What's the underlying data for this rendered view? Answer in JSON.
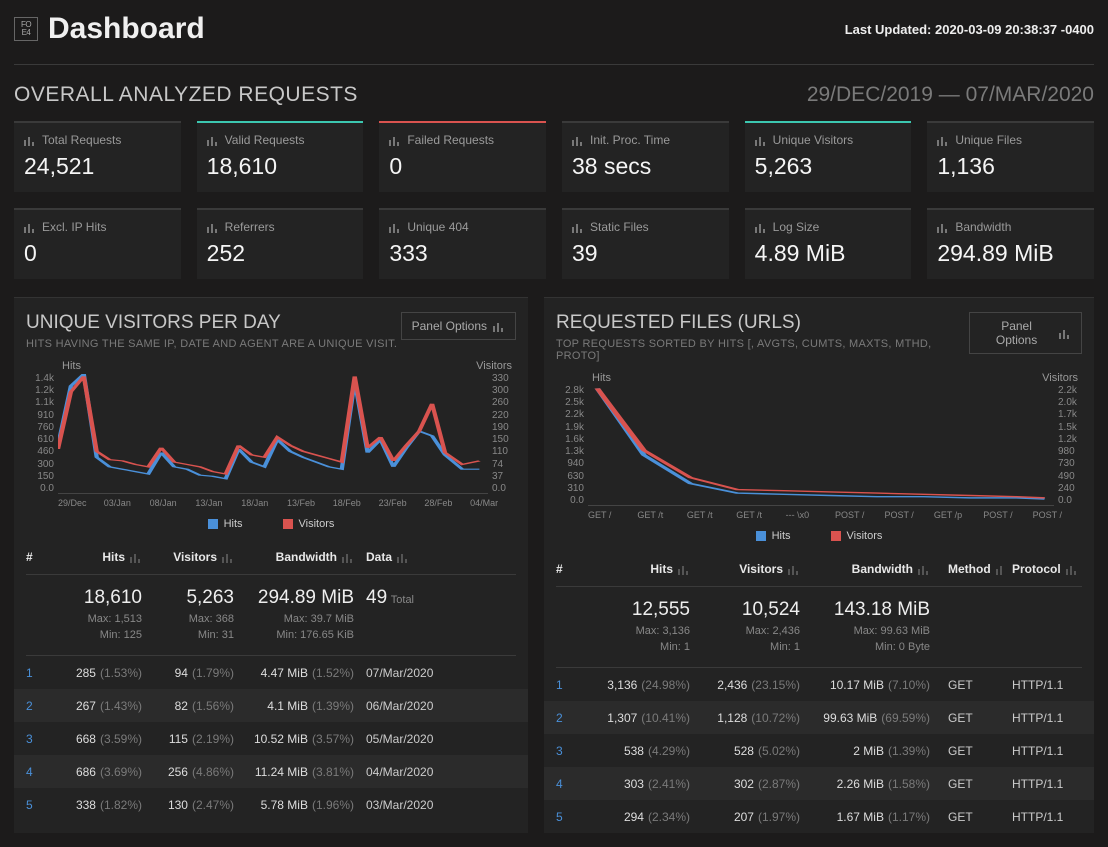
{
  "header": {
    "brand": "Dashboard",
    "last_updated_label": "Last Updated:",
    "last_updated_value": "2020-03-09 20:38:37 -0400"
  },
  "overview": {
    "title": "OVERALL ANALYZED REQUESTS",
    "date_range": "29/DEC/2019 — 07/MAR/2020",
    "cards": [
      {
        "label": "Total Requests",
        "value": "24,521",
        "accent": ""
      },
      {
        "label": "Valid Requests",
        "value": "18,610",
        "accent": "green"
      },
      {
        "label": "Failed Requests",
        "value": "0",
        "accent": "red"
      },
      {
        "label": "Init. Proc. Time",
        "value": "38 secs",
        "accent": ""
      },
      {
        "label": "Unique Visitors",
        "value": "5,263",
        "accent": "teal"
      },
      {
        "label": "Unique Files",
        "value": "1,136",
        "accent": ""
      },
      {
        "label": "Excl. IP Hits",
        "value": "0",
        "accent": ""
      },
      {
        "label": "Referrers",
        "value": "252",
        "accent": ""
      },
      {
        "label": "Unique 404",
        "value": "333",
        "accent": ""
      },
      {
        "label": "Static Files",
        "value": "39",
        "accent": ""
      },
      {
        "label": "Log Size",
        "value": "4.89 MiB",
        "accent": ""
      },
      {
        "label": "Bandwidth",
        "value": "294.89 MiB",
        "accent": ""
      }
    ]
  },
  "panel_options_label": "Panel Options",
  "legend": {
    "hits": "Hits",
    "visitors": "Visitors"
  },
  "visitors_panel": {
    "title": "UNIQUE VISITORS PER DAY",
    "subtitle": "HITS HAVING THE SAME IP, DATE AND AGENT ARE A UNIQUE VISIT.",
    "chart": {
      "hits_label": "Hits",
      "visitors_label": "Visitors",
      "y_left": [
        "1.4k",
        "1.2k",
        "1.1k",
        "910",
        "760",
        "610",
        "460",
        "300",
        "150",
        "0.0"
      ],
      "y_right": [
        "330",
        "300",
        "260",
        "220",
        "190",
        "150",
        "110",
        "74",
        "37",
        "0.0"
      ],
      "x": [
        "29/Dec",
        "03/Jan",
        "08/Jan",
        "13/Jan",
        "18/Jan",
        "13/Feb",
        "18/Feb",
        "23/Feb",
        "28/Feb",
        "04/Mar"
      ]
    },
    "columns": [
      "#",
      "Hits",
      "Visitors",
      "Bandwidth",
      "Data"
    ],
    "summary": {
      "hits": "18,610",
      "hits_max": "Max: 1,513",
      "hits_min": "Min: 125",
      "visitors": "5,263",
      "visitors_max": "Max: 368",
      "visitors_min": "Min: 31",
      "bw": "294.89 MiB",
      "bw_max": "Max: 39.7 MiB",
      "bw_min": "Min: 176.65 KiB",
      "data": "49",
      "data_label": "Total"
    },
    "rows": [
      {
        "i": "1",
        "hits": "285",
        "hits_pct": "(1.53%)",
        "vis": "94",
        "vis_pct": "(1.79%)",
        "bw": "4.47 MiB",
        "bw_pct": "(1.52%)",
        "date": "07/Mar/2020"
      },
      {
        "i": "2",
        "hits": "267",
        "hits_pct": "(1.43%)",
        "vis": "82",
        "vis_pct": "(1.56%)",
        "bw": "4.1 MiB",
        "bw_pct": "(1.39%)",
        "date": "06/Mar/2020"
      },
      {
        "i": "3",
        "hits": "668",
        "hits_pct": "(3.59%)",
        "vis": "115",
        "vis_pct": "(2.19%)",
        "bw": "10.52 MiB",
        "bw_pct": "(3.57%)",
        "date": "05/Mar/2020"
      },
      {
        "i": "4",
        "hits": "686",
        "hits_pct": "(3.69%)",
        "vis": "256",
        "vis_pct": "(4.86%)",
        "bw": "11.24 MiB",
        "bw_pct": "(3.81%)",
        "date": "04/Mar/2020"
      },
      {
        "i": "5",
        "hits": "338",
        "hits_pct": "(1.82%)",
        "vis": "130",
        "vis_pct": "(2.47%)",
        "bw": "5.78 MiB",
        "bw_pct": "(1.96%)",
        "date": "03/Mar/2020"
      }
    ]
  },
  "files_panel": {
    "title": "REQUESTED FILES (URLS)",
    "subtitle": "TOP REQUESTS SORTED BY HITS [, AVGTS, CUMTS, MAXTS, MTHD, PROTO]",
    "chart": {
      "hits_label": "Hits",
      "visitors_label": "Visitors",
      "y_left": [
        "2.8k",
        "2.5k",
        "2.2k",
        "1.9k",
        "1.6k",
        "1.3k",
        "940",
        "630",
        "310",
        "0.0"
      ],
      "y_right": [
        "2.2k",
        "2.0k",
        "1.7k",
        "1.5k",
        "1.2k",
        "980",
        "730",
        "490",
        "240",
        "0.0"
      ],
      "x": [
        "GET /",
        "GET /t",
        "GET /t",
        "GET /t",
        "--- \\x0",
        "POST /",
        "POST /",
        "GET /p",
        "POST /",
        "POST /"
      ]
    },
    "columns": [
      "#",
      "Hits",
      "Visitors",
      "Bandwidth",
      "Method",
      "Protocol"
    ],
    "summary": {
      "hits": "12,555",
      "hits_max": "Max: 3,136",
      "hits_min": "Min: 1",
      "visitors": "10,524",
      "visitors_max": "Max: 2,436",
      "visitors_min": "Min: 1",
      "bw": "143.18 MiB",
      "bw_max": "Max: 99.63 MiB",
      "bw_min": "Min: 0 Byte"
    },
    "rows": [
      {
        "i": "1",
        "hits": "3,136",
        "hits_pct": "(24.98%)",
        "vis": "2,436",
        "vis_pct": "(23.15%)",
        "bw": "10.17 MiB",
        "bw_pct": "(7.10%)",
        "method": "GET",
        "proto": "HTTP/1.1"
      },
      {
        "i": "2",
        "hits": "1,307",
        "hits_pct": "(10.41%)",
        "vis": "1,128",
        "vis_pct": "(10.72%)",
        "bw": "99.63 MiB",
        "bw_pct": "(69.59%)",
        "method": "GET",
        "proto": "HTTP/1.1"
      },
      {
        "i": "3",
        "hits": "538",
        "hits_pct": "(4.29%)",
        "vis": "528",
        "vis_pct": "(5.02%)",
        "bw": "2 MiB",
        "bw_pct": "(1.39%)",
        "method": "GET",
        "proto": "HTTP/1.1"
      },
      {
        "i": "4",
        "hits": "303",
        "hits_pct": "(2.41%)",
        "vis": "302",
        "vis_pct": "(2.87%)",
        "bw": "2.26 MiB",
        "bw_pct": "(1.58%)",
        "method": "GET",
        "proto": "HTTP/1.1"
      },
      {
        "i": "5",
        "hits": "294",
        "hits_pct": "(2.34%)",
        "vis": "207",
        "vis_pct": "(1.97%)",
        "bw": "1.67 MiB",
        "bw_pct": "(1.17%)",
        "method": "GET",
        "proto": "HTTP/1.1"
      }
    ]
  },
  "chart_data": [
    {
      "type": "line",
      "title": "Unique Visitors Per Day",
      "x": [
        "29/Dec",
        "03/Jan",
        "08/Jan",
        "13/Jan",
        "18/Jan",
        "13/Feb",
        "18/Feb",
        "23/Feb",
        "28/Feb",
        "04/Mar"
      ],
      "series": [
        {
          "name": "Hits",
          "ylim": [
            0,
            1400
          ],
          "values": [
            600,
            1350,
            1500,
            400,
            300,
            280,
            250,
            220,
            450,
            300,
            260,
            220,
            200,
            180,
            500,
            350,
            300,
            600,
            480,
            400,
            350,
            320,
            280,
            1320,
            450,
            600,
            300,
            500,
            700,
            650,
            440,
            280,
            290
          ]
        },
        {
          "name": "Visitors",
          "ylim": [
            0,
            330
          ],
          "values": [
            120,
            300,
            330,
            120,
            95,
            90,
            80,
            75,
            130,
            90,
            82,
            78,
            65,
            58,
            140,
            110,
            100,
            160,
            140,
            120,
            110,
            100,
            90,
            330,
            130,
            160,
            95,
            140,
            180,
            256,
            115,
            82,
            94
          ]
        }
      ]
    },
    {
      "type": "line",
      "title": "Requested Files (URLs)",
      "x": [
        "GET /",
        "GET /t",
        "GET /t",
        "GET /t",
        "--- \\x0",
        "POST /",
        "POST /",
        "GET /p",
        "POST /",
        "POST /"
      ],
      "series": [
        {
          "name": "Hits",
          "ylim": [
            0,
            2800
          ],
          "values": [
            2800,
            1200,
            500,
            280,
            260,
            230,
            210,
            190,
            170,
            150
          ]
        },
        {
          "name": "Visitors",
          "ylim": [
            0,
            2200
          ],
          "values": [
            2200,
            1050,
            520,
            300,
            270,
            240,
            210,
            180,
            160,
            140
          ]
        }
      ]
    }
  ]
}
